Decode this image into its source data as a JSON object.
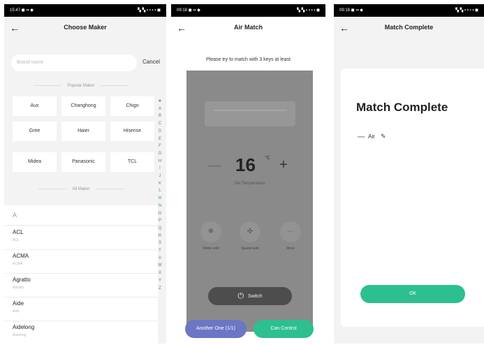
{
  "screen1": {
    "status": {
      "left": "15:47 ◼ ▪▪ ◆",
      "right": "▚ ▚ ▪ ▪ ▪ ▪ ◼"
    },
    "title": "Choose Maker",
    "search_placeholder": "Brand name",
    "cancel_label": "Cancel",
    "popular_label": "Popular Maker",
    "popular": [
      "Aux",
      "Changhong",
      "Chigo",
      "Gree",
      "Haier",
      "Hisense",
      "Midea",
      "Panasonic",
      "TCL"
    ],
    "all_label": "All Maker",
    "index_letters": [
      "★",
      "A",
      "B",
      "C",
      "D",
      "E",
      "F",
      "G",
      "H",
      "I",
      "J",
      "K",
      "L",
      "M",
      "N",
      "O",
      "P",
      "Q",
      "R",
      "S",
      "T",
      "V",
      "W",
      "X",
      "Y",
      "Z"
    ],
    "section_letter": "A",
    "brands": [
      {
        "name": "ACL",
        "sub": "ACL"
      },
      {
        "name": "ACMA",
        "sub": "ACMA"
      },
      {
        "name": "Agratto",
        "sub": "Agratto"
      },
      {
        "name": "Aide",
        "sub": "Aide"
      },
      {
        "name": "Aidelong",
        "sub": "Aidelong"
      }
    ]
  },
  "screen2": {
    "status": {
      "left": "09:18 ◼ ▪▪ ◆",
      "right": "▚ ▚ ▪ ▪ ▪ ▪ ◼"
    },
    "title": "Air Match",
    "subtitle": "Please try to match with 3 keys at least",
    "temperature": "16",
    "temp_unit": "°C",
    "set_label": "Set Temperature",
    "minus": "—",
    "plus": "+",
    "mode_label": "Mode cold",
    "speed_label": "Speed auto",
    "more_label": "More",
    "switch_label": "Switch",
    "another_label": "Another One (1/1)",
    "control_label": "Can Control",
    "colors": {
      "accent": "#2dbf8f",
      "another": "#6b76c4",
      "remote": "#8a8a8a"
    }
  },
  "screen3": {
    "status": {
      "left": "09:18 ◼ ▪▪ ◆",
      "right": "▚ ▚ ▪ ▪ ▪ ▪ ◼"
    },
    "title": "Match Complete",
    "card_title": "Match Complete",
    "device_name": "Air",
    "ok_label": "OK"
  }
}
